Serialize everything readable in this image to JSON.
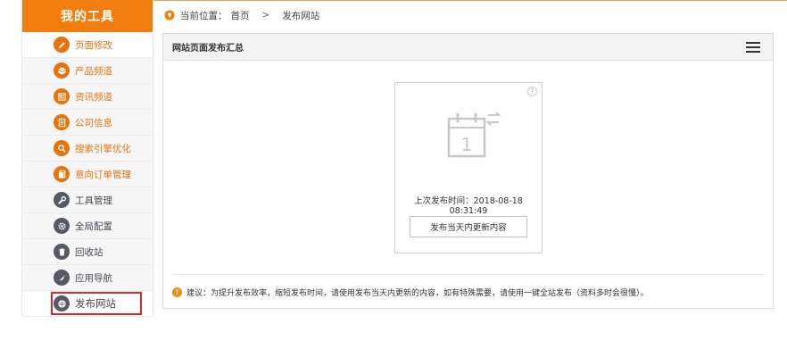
{
  "sidebar": {
    "title": "我的工具",
    "items": [
      {
        "label": "页面修改",
        "icon": "pencil-icon"
      },
      {
        "label": "产品频道",
        "icon": "box-icon"
      },
      {
        "label": "资讯频道",
        "icon": "news-icon"
      },
      {
        "label": "公司信息",
        "icon": "document-icon"
      },
      {
        "label": "搜索引擎优化",
        "icon": "search-icon"
      },
      {
        "label": "意向订单管理",
        "icon": "orders-icon"
      },
      {
        "label": "工具管理",
        "icon": "wrench-icon"
      },
      {
        "label": "全局配置",
        "icon": "gear-icon"
      },
      {
        "label": "回收站",
        "icon": "trash-icon"
      },
      {
        "label": "应用导航",
        "icon": "compass-icon"
      },
      {
        "label": "发布网站",
        "icon": "globe-icon"
      }
    ]
  },
  "breadcrumb": {
    "prefix": "当前位置：",
    "home": "首页",
    "separator": ">",
    "current": "发布网站"
  },
  "panel": {
    "title": "网站页面发布汇总",
    "help_symbol": "?",
    "calendar_day": "1",
    "last_publish": "上次发布时间：2018-08-18 08:31:49",
    "publish_button": "发布当天内更新内容",
    "tip": "建议：为提升发布效率，缩短发布时间，请使用发布当天内更新的内容，如有特殊需要，请使用一键全站发布（资料多时会很慢）。",
    "warn_symbol": "!"
  },
  "colors": {
    "brand_orange": "#f07d0e",
    "active_border": "#d9282d"
  }
}
